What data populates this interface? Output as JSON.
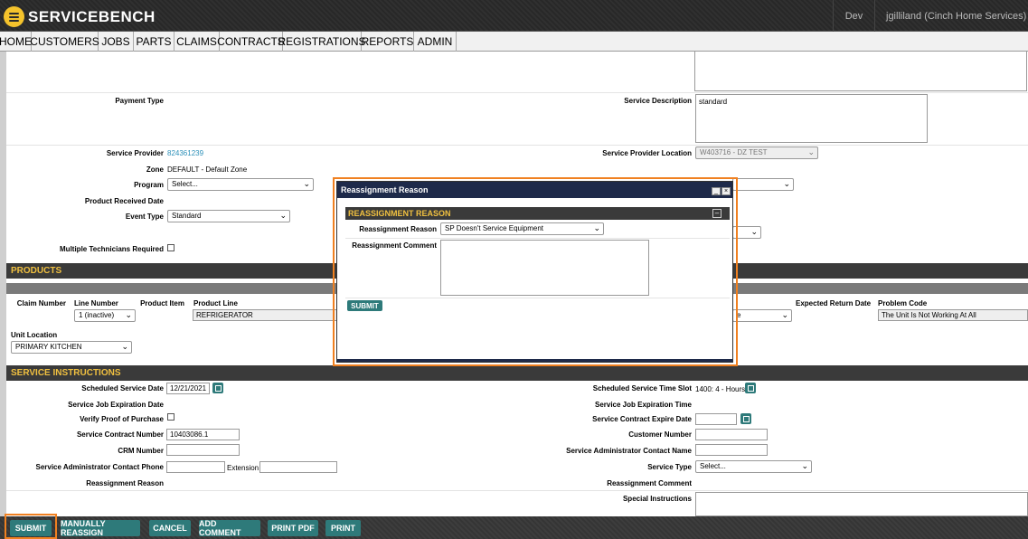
{
  "app": {
    "brand": "SERVICEBENCH",
    "env": "Dev",
    "user": "jgilliland (Cinch Home Services)"
  },
  "nav": [
    "HOME",
    "CUSTOMERS",
    "JOBS",
    "PARTS",
    "CLAIMS",
    "CONTRACTS",
    "REGISTRATIONS",
    "REPORTS",
    "ADMIN"
  ],
  "form": {
    "payment_type_label": "Payment Type",
    "service_description_label": "Service Description",
    "service_description_value": "standard",
    "service_provider_label": "Service Provider",
    "service_provider_value": "824361239",
    "service_provider_location_label": "Service Provider Location",
    "service_provider_location_value": "W403716 - DZ TEST",
    "zone_label": "Zone",
    "zone_value": "DEFAULT - Default Zone",
    "program_label": "Program",
    "program_value": "Select...",
    "product_received_label": "Product Received Date",
    "event_type_label": "Event Type",
    "event_type_value": "Standard",
    "multi_tech_label": "Multiple Technicians Required"
  },
  "products": {
    "title": "PRODUCTS",
    "claim_number_label": "Claim Number",
    "line_number_label": "Line Number",
    "line_number_value": "1 (inactive)",
    "product_item_label": "Product Item",
    "product_line_label": "Product Line",
    "product_line_value": "REFRIGERATOR",
    "partial_select_value": "e",
    "expected_return_label": "Expected Return Date",
    "problem_code_label": "Problem Code",
    "problem_code_value": "The Unit Is Not Working At All",
    "unit_location_label": "Unit Location",
    "unit_location_value": "PRIMARY KITCHEN"
  },
  "service": {
    "title": "SERVICE INSTRUCTIONS",
    "scheduled_date_label": "Scheduled Service Date",
    "scheduled_date_value": "12/21/2021",
    "time_slot_label": "Scheduled Service Time Slot",
    "time_slot_value": "1400: 4 - Hours",
    "job_exp_date_label": "Service Job Expiration Date",
    "job_exp_time_label": "Service Job Expiration Time",
    "verify_label": "Verify Proof of Purchase",
    "contract_expire_label": "Service Contract Expire Date",
    "contract_number_label": "Service Contract Number",
    "contract_number_value": "10403086.1",
    "customer_number_label": "Customer Number",
    "crm_label": "CRM Number",
    "admin_name_label": "Service Administrator Contact Name",
    "admin_phone_label": "Service Administrator Contact Phone",
    "extension_label": "Extension",
    "service_type_label": "Service Type",
    "service_type_value": "Select...",
    "reassign_reason_label": "Reassignment Reason",
    "reassign_comment_label": "Reassignment Comment",
    "special_instr_label": "Special Instructions"
  },
  "modal": {
    "title": "Reassignment Reason",
    "section": "REASSIGNMENT REASON",
    "reason_label": "Reassignment Reason",
    "reason_value": "SP Doesn't Service Equipment",
    "comment_label": "Reassignment Comment",
    "submit": "SUBMIT",
    "min_btn": "_",
    "close_btn": "×",
    "collapse_btn": "–"
  },
  "footer": [
    "SUBMIT",
    "MANUALLY REASSIGN",
    "CANCEL",
    "ADD COMMENT",
    "PRINT PDF",
    "PRINT"
  ],
  "colors": {
    "accent": "#2e7a7a",
    "section_text": "#f0c040",
    "highlight": "#f08020",
    "modal_title": "#1e2a4a"
  }
}
